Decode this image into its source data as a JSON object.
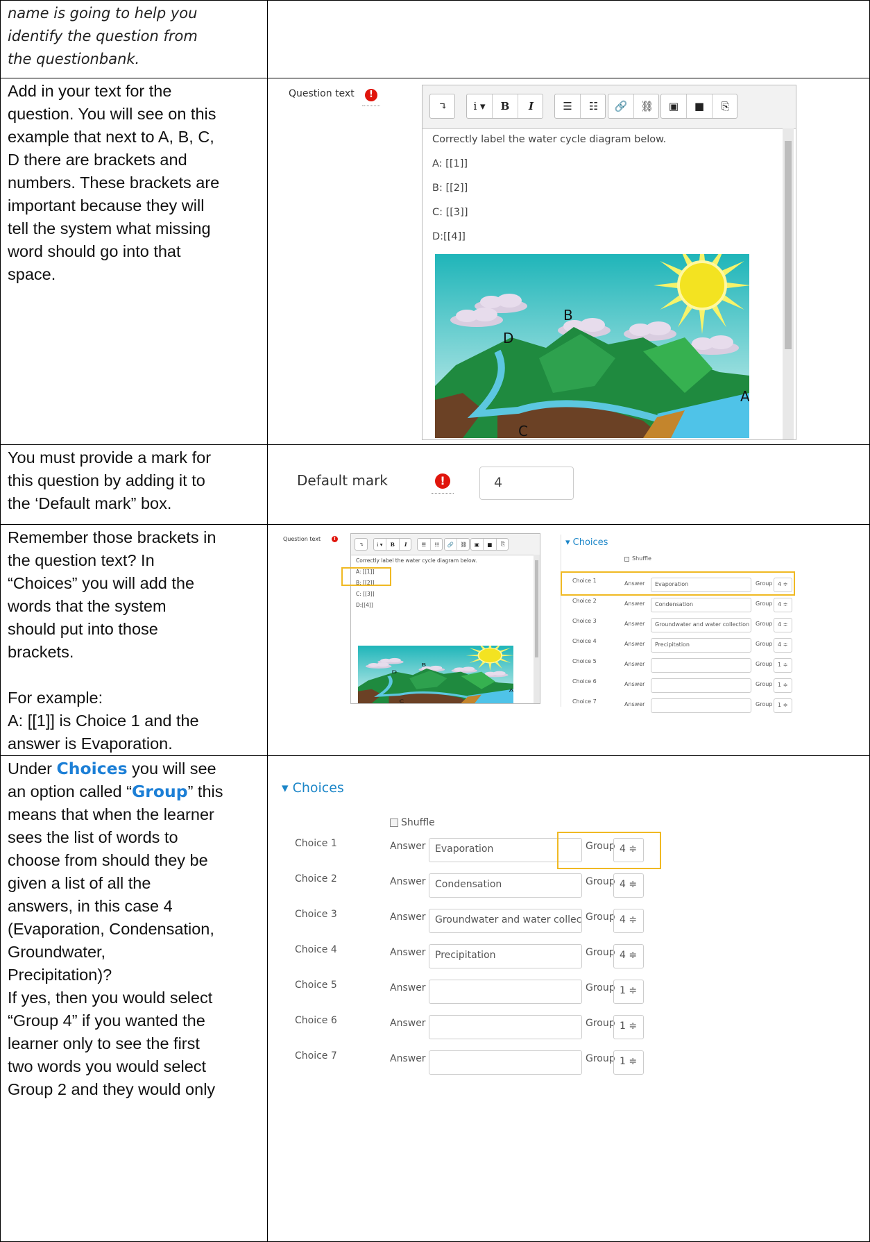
{
  "rows": {
    "r0": {
      "lines": [
        "name is going to help you",
        "identify the question from",
        "the questionbank."
      ]
    },
    "r1": {
      "lines": [
        "Add in your text for the",
        "question. You will see on this",
        "example that next to A, B, C,",
        "D there are brackets and",
        "numbers. These brackets are",
        "important because they will",
        "tell the system what missing",
        "word should go into that",
        "space."
      ]
    },
    "r2": {
      "lines": [
        "You must provide a mark for",
        "this question by adding it to",
        "the ‘Default mark” box."
      ]
    },
    "r3": {
      "lines_a": [
        "Remember those brackets in",
        "the question text? In",
        "“Choices” you will add the",
        "words that the system",
        "should put into those",
        "brackets."
      ],
      "lines_b": [
        "For example:",
        "A: [[1]] is Choice 1 and the",
        "answer is Evaporation."
      ]
    },
    "r4": {
      "line1_pre": "Under ",
      "line1_bold": "Choices",
      "line1_post": " you will see",
      "line2_pre": "an option called “",
      "line2_bold": "Group",
      "line2_post": "” this",
      "lines": [
        "means that when the learner",
        "sees the list of words to",
        "choose from should they be",
        "given a list of all the",
        "answers, in this case 4",
        "(Evaporation, Condensation,",
        "Groundwater,",
        "Precipitation)?",
        "If yes, then you would select",
        "“Group 4” if you wanted the",
        "learner only to see the first",
        "two words you would select",
        "Group 2 and they would only"
      ]
    }
  },
  "editor": {
    "label": "Question text",
    "warning_icon": "!",
    "toolbar": {
      "groups": [
        [
          "↴"
        ],
        [
          "i ▾",
          "B",
          "I"
        ],
        [
          "☰",
          "☷"
        ],
        [
          "🔗",
          "⛓"
        ],
        [
          "▣",
          "■",
          "⎘"
        ]
      ]
    },
    "text_lines": [
      "Correctly label the water cycle diagram below.",
      "A: [[1]]",
      "B: [[2]]",
      "C: [[3]]",
      "D:[[4]]"
    ],
    "diagram_labels": [
      "B",
      "D",
      "A",
      "C"
    ]
  },
  "default_mark": {
    "label": "Default mark",
    "value": "4"
  },
  "choices": {
    "title": "▾ Choices",
    "shuffle_label": "Shuffle",
    "answer_label": "Answer",
    "group_label": "Group",
    "items": [
      {
        "label": "Choice 1",
        "answer": "Evaporation",
        "group": "4 ≑"
      },
      {
        "label": "Choice 2",
        "answer": "Condensation",
        "group": "4 ≑"
      },
      {
        "label": "Choice 3",
        "answer": "Groundwater and water collection",
        "group": "4 ≑"
      },
      {
        "label": "Choice 4",
        "answer": "Precipitation",
        "group": "4 ≑"
      },
      {
        "label": "Choice 5",
        "answer": "",
        "group": "1 ≑"
      },
      {
        "label": "Choice 6",
        "answer": "",
        "group": "1 ≑"
      },
      {
        "label": "Choice 7",
        "answer": "",
        "group": "1 ≑"
      }
    ]
  },
  "colors": {
    "highlight": "#f0b923",
    "link_blue": "#1c7fd6",
    "warning_red": "#e0150c"
  }
}
